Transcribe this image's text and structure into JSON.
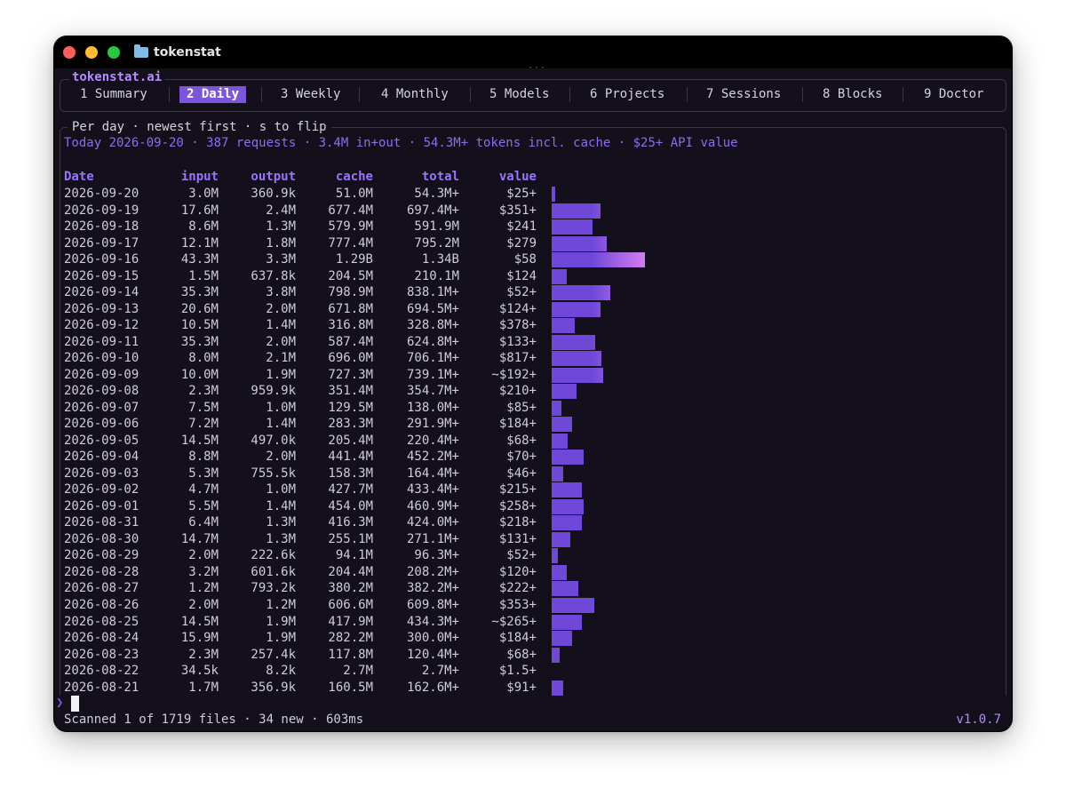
{
  "window": {
    "title": "tokenstat"
  },
  "app": {
    "brand": "tokenstat.ai",
    "version": "v1.0.7"
  },
  "tabs": [
    {
      "label": "1 Summary",
      "active": false
    },
    {
      "label": "2 Daily",
      "active": true
    },
    {
      "label": "3 Weekly",
      "active": false
    },
    {
      "label": "4 Monthly",
      "active": false
    },
    {
      "label": "5 Models",
      "active": false
    },
    {
      "label": "6 Projects",
      "active": false
    },
    {
      "label": "7 Sessions",
      "active": false
    },
    {
      "label": "8 Blocks",
      "active": false
    },
    {
      "label": "9 Doctor",
      "active": false
    }
  ],
  "panel": {
    "title": "Per day · newest first · s to flip",
    "today": "Today 2026-09-20 · 387 requests · 3.4M in+out · 54.3M+ tokens incl. cache · $25+ API value"
  },
  "table": {
    "headers": {
      "date": "Date",
      "input": "input",
      "output": "output",
      "cache": "cache",
      "total": "total",
      "value": "value"
    },
    "rows": [
      {
        "date": "2026-09-20",
        "input": "3.0M",
        "output": "360.9k",
        "cache": "51.0M",
        "total": "54.3M+",
        "value": "$25+",
        "bar": 0.04
      },
      {
        "date": "2026-09-19",
        "input": "17.6M",
        "output": "2.4M",
        "cache": "677.4M",
        "total": "697.4M+",
        "value": "$351+",
        "bar": 0.52
      },
      {
        "date": "2026-09-18",
        "input": "8.6M",
        "output": "1.3M",
        "cache": "579.9M",
        "total": "591.9M",
        "value": "$241",
        "bar": 0.44
      },
      {
        "date": "2026-09-17",
        "input": "12.1M",
        "output": "1.8M",
        "cache": "777.4M",
        "total": "795.2M",
        "value": "$279",
        "bar": 0.59
      },
      {
        "date": "2026-09-16",
        "input": "43.3M",
        "output": "3.3M",
        "cache": "1.29B",
        "total": "1.34B",
        "value": "$58",
        "bar": 1.0
      },
      {
        "date": "2026-09-15",
        "input": "1.5M",
        "output": "637.8k",
        "cache": "204.5M",
        "total": "210.1M",
        "value": "$124",
        "bar": 0.16
      },
      {
        "date": "2026-09-14",
        "input": "35.3M",
        "output": "3.8M",
        "cache": "798.9M",
        "total": "838.1M+",
        "value": "$52+",
        "bar": 0.63
      },
      {
        "date": "2026-09-13",
        "input": "20.6M",
        "output": "2.0M",
        "cache": "671.8M",
        "total": "694.5M+",
        "value": "$124+",
        "bar": 0.52
      },
      {
        "date": "2026-09-12",
        "input": "10.5M",
        "output": "1.4M",
        "cache": "316.8M",
        "total": "328.8M+",
        "value": "$378+",
        "bar": 0.25
      },
      {
        "date": "2026-09-11",
        "input": "35.3M",
        "output": "2.0M",
        "cache": "587.4M",
        "total": "624.8M+",
        "value": "$133+",
        "bar": 0.47
      },
      {
        "date": "2026-09-10",
        "input": "8.0M",
        "output": "2.1M",
        "cache": "696.0M",
        "total": "706.1M+",
        "value": "$817+",
        "bar": 0.53
      },
      {
        "date": "2026-09-09",
        "input": "10.0M",
        "output": "1.9M",
        "cache": "727.3M",
        "total": "739.1M+",
        "value": "~$192+",
        "bar": 0.55
      },
      {
        "date": "2026-09-08",
        "input": "2.3M",
        "output": "959.9k",
        "cache": "351.4M",
        "total": "354.7M+",
        "value": "$210+",
        "bar": 0.27
      },
      {
        "date": "2026-09-07",
        "input": "7.5M",
        "output": "1.0M",
        "cache": "129.5M",
        "total": "138.0M+",
        "value": "$85+",
        "bar": 0.1
      },
      {
        "date": "2026-09-06",
        "input": "7.2M",
        "output": "1.4M",
        "cache": "283.3M",
        "total": "291.9M+",
        "value": "$184+",
        "bar": 0.22
      },
      {
        "date": "2026-09-05",
        "input": "14.5M",
        "output": "497.0k",
        "cache": "205.4M",
        "total": "220.4M+",
        "value": "$68+",
        "bar": 0.17
      },
      {
        "date": "2026-09-04",
        "input": "8.8M",
        "output": "2.0M",
        "cache": "441.4M",
        "total": "452.2M+",
        "value": "$70+",
        "bar": 0.34
      },
      {
        "date": "2026-09-03",
        "input": "5.3M",
        "output": "755.5k",
        "cache": "158.3M",
        "total": "164.4M+",
        "value": "$46+",
        "bar": 0.12
      },
      {
        "date": "2026-09-02",
        "input": "4.7M",
        "output": "1.0M",
        "cache": "427.7M",
        "total": "433.4M+",
        "value": "$215+",
        "bar": 0.32
      },
      {
        "date": "2026-09-01",
        "input": "5.5M",
        "output": "1.4M",
        "cache": "454.0M",
        "total": "460.9M+",
        "value": "$258+",
        "bar": 0.34
      },
      {
        "date": "2026-08-31",
        "input": "6.4M",
        "output": "1.3M",
        "cache": "416.3M",
        "total": "424.0M+",
        "value": "$218+",
        "bar": 0.32
      },
      {
        "date": "2026-08-30",
        "input": "14.7M",
        "output": "1.3M",
        "cache": "255.1M",
        "total": "271.1M+",
        "value": "$131+",
        "bar": 0.2
      },
      {
        "date": "2026-08-29",
        "input": "2.0M",
        "output": "222.6k",
        "cache": "94.1M",
        "total": "96.3M+",
        "value": "$52+",
        "bar": 0.07
      },
      {
        "date": "2026-08-28",
        "input": "3.2M",
        "output": "601.6k",
        "cache": "204.4M",
        "total": "208.2M+",
        "value": "$120+",
        "bar": 0.16
      },
      {
        "date": "2026-08-27",
        "input": "1.2M",
        "output": "793.2k",
        "cache": "380.2M",
        "total": "382.2M+",
        "value": "$222+",
        "bar": 0.29
      },
      {
        "date": "2026-08-26",
        "input": "2.0M",
        "output": "1.2M",
        "cache": "606.6M",
        "total": "609.8M+",
        "value": "$353+",
        "bar": 0.46
      },
      {
        "date": "2026-08-25",
        "input": "14.5M",
        "output": "1.9M",
        "cache": "417.9M",
        "total": "434.3M+",
        "value": "~$265+",
        "bar": 0.32
      },
      {
        "date": "2026-08-24",
        "input": "15.9M",
        "output": "1.9M",
        "cache": "282.2M",
        "total": "300.0M+",
        "value": "$184+",
        "bar": 0.22
      },
      {
        "date": "2026-08-23",
        "input": "2.3M",
        "output": "257.4k",
        "cache": "117.8M",
        "total": "120.4M+",
        "value": "$68+",
        "bar": 0.09
      },
      {
        "date": "2026-08-22",
        "input": "34.5k",
        "output": "8.2k",
        "cache": "2.7M",
        "total": "2.7M+",
        "value": "$1.5+",
        "bar": 0.0
      },
      {
        "date": "2026-08-21",
        "input": "1.7M",
        "output": "356.9k",
        "cache": "160.5M",
        "total": "162.6M+",
        "value": "$91+",
        "bar": 0.12
      }
    ]
  },
  "prompt": {
    "caret": "❯"
  },
  "status": {
    "text": "Scanned 1 of 1719 files · 34 new · 603ms"
  },
  "colors": {
    "accent": "#7d55dd",
    "header": "#9a73ff",
    "bar_start": "#6f48d8",
    "bar_end": "#d37df0"
  }
}
